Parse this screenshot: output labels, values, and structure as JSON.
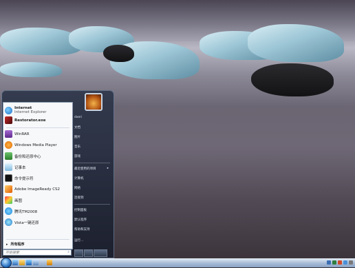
{
  "start_menu": {
    "pinned": [
      {
        "title": "Internet",
        "subtitle": "Internet Explorer",
        "icon": "ie-icon"
      },
      {
        "title": "Restorator.exe",
        "subtitle": "",
        "icon": "restorator-icon"
      }
    ],
    "recent": [
      {
        "label": "WinRAR",
        "icon": "winrar-icon"
      },
      {
        "label": "Windows Media Player",
        "icon": "media-player-icon"
      },
      {
        "label": "备份和还原中心",
        "icon": "backup-icon"
      },
      {
        "label": "记事本",
        "icon": "notepad-icon"
      },
      {
        "label": "命令提示符",
        "icon": "cmd-icon"
      },
      {
        "label": "Adobe ImageReady CS2",
        "icon": "imageready-icon"
      },
      {
        "label": "画图",
        "icon": "paint-icon"
      },
      {
        "label": "腾讯TM2008",
        "icon": "tm-icon"
      },
      {
        "label": "Vista一键还原",
        "icon": "vista-restore-icon"
      }
    ],
    "all_programs": "所有程序",
    "search_placeholder": "开始搜索",
    "right_items": [
      "dxeri",
      "文档",
      "图片",
      "音乐",
      "游戏",
      "最近使用的项目",
      "计算机",
      "网络",
      "连接到",
      "控制面板",
      "默认程序",
      "帮助和支持",
      "运行..."
    ]
  }
}
